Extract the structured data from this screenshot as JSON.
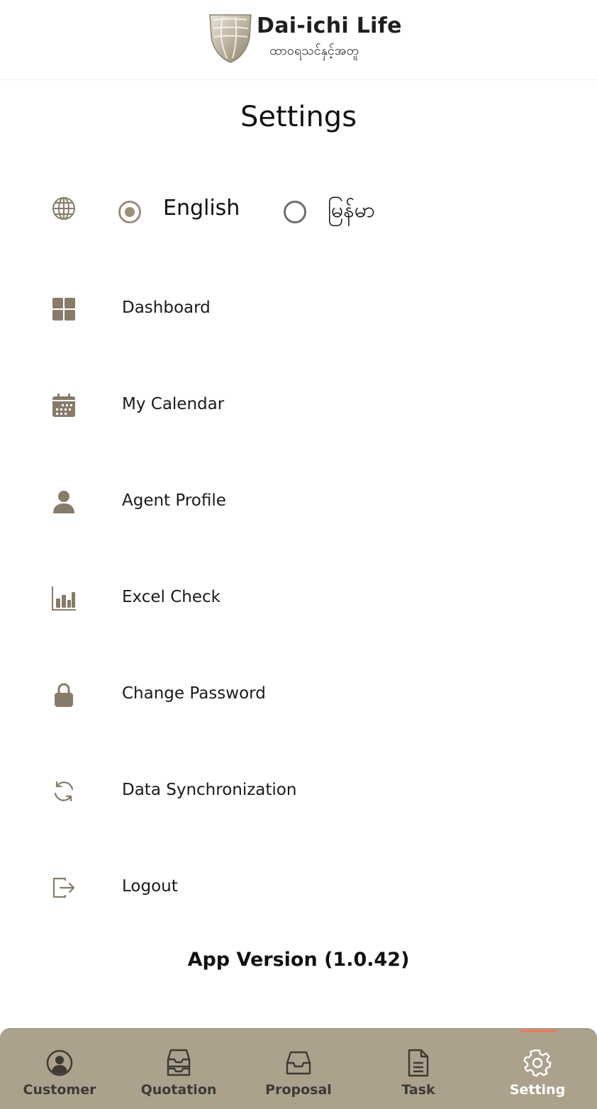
{
  "header": {
    "brand_name": "Dai-ichi Life",
    "brand_subtitle": "ထာဝရသင်နှင့်အတူ"
  },
  "page_title": "Settings",
  "language": {
    "icon": "globe-icon",
    "selected": "English",
    "options": [
      {
        "label": "English",
        "checked": true
      },
      {
        "label": "မြန်မာ",
        "checked": false
      }
    ]
  },
  "menu": {
    "items": [
      {
        "label": "Dashboard",
        "icon": "dashboard-grid-icon"
      },
      {
        "label": "My Calendar",
        "icon": "calendar-icon"
      },
      {
        "label": "Agent Profile",
        "icon": "person-icon"
      },
      {
        "label": "Excel Check",
        "icon": "bar-chart-icon"
      },
      {
        "label": "Change Password",
        "icon": "lock-icon"
      },
      {
        "label": "Data Synchronization",
        "icon": "sync-icon"
      },
      {
        "label": "Logout",
        "icon": "logout-icon"
      }
    ]
  },
  "app_version": "App Version (1.0.42)",
  "tabbar": {
    "active": "Setting",
    "tabs": [
      {
        "label": "Customer",
        "icon": "user-circle-icon"
      },
      {
        "label": "Quotation",
        "icon": "inbox-stack-icon"
      },
      {
        "label": "Proposal",
        "icon": "inbox-icon"
      },
      {
        "label": "Task",
        "icon": "document-icon"
      },
      {
        "label": "Setting",
        "icon": "gear-icon"
      }
    ]
  },
  "colors": {
    "accent": "#9b8f7c",
    "icon": "#877b69",
    "tabbar_bg": "#aba18d",
    "tab_active_indicator": "#e0805a"
  }
}
